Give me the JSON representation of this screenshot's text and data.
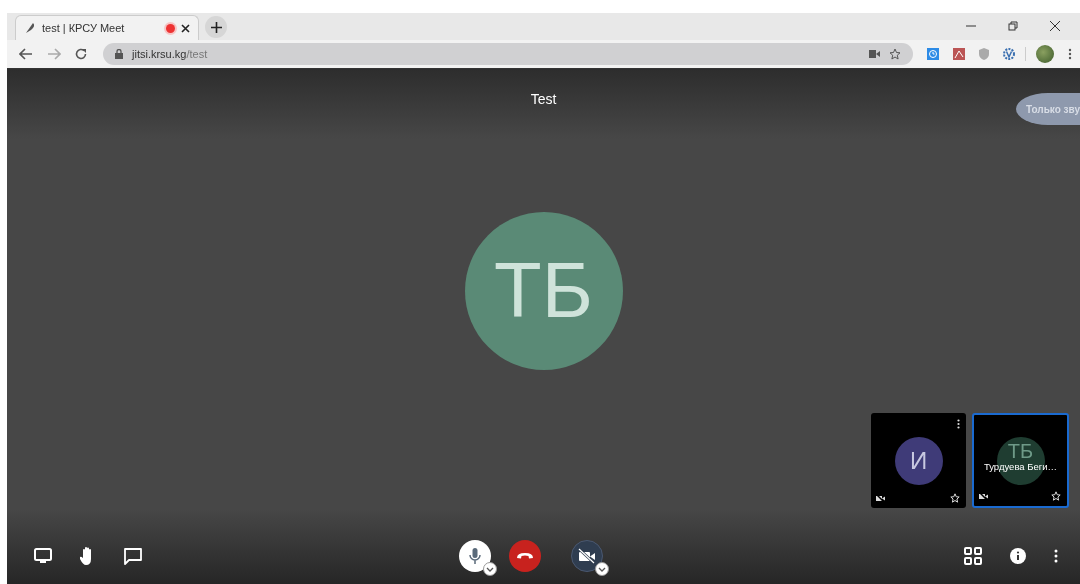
{
  "browser": {
    "tab": {
      "title": "test | КРСУ Meet",
      "recording": true
    },
    "url": {
      "host": "jitsi.krsu.kg",
      "path": "/test"
    }
  },
  "meeting": {
    "title": "Test",
    "audio_only_label": "Только зву",
    "speaker": {
      "initials": "ТБ",
      "color": "#5a8a76"
    },
    "thumbnails": [
      {
        "initials": "И",
        "color": "#3f3b78",
        "selected": false,
        "menu": true
      },
      {
        "initials": "ТБ",
        "color": "#1f3d31",
        "name": "Турдуева Беги…",
        "selected": true,
        "menu": false
      }
    ]
  },
  "toolbar": {
    "mic_muted": false,
    "camera_muted": true
  }
}
